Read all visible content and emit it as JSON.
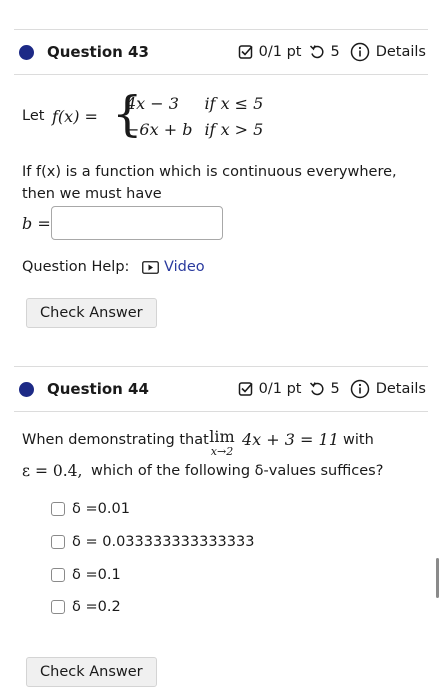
{
  "q43": {
    "title": "Question 43",
    "score": "0/1 pt",
    "attempts": "5",
    "details": "Details",
    "let_text": "Let",
    "fx": "f(x) =",
    "case1_expr": "4x − 3",
    "case1_cond": "if  x ≤ 5",
    "case2_expr": "−6x + b",
    "case2_cond": "if  x > 5",
    "prompt_line1": "If f(x) is a function which is continuous everywhere,",
    "prompt_line2": "then we must have",
    "answer_label": "b =",
    "answer_value": "",
    "help_label": "Question Help:",
    "video_label": "Video",
    "check_label": "Check Answer"
  },
  "q44": {
    "title": "Question 44",
    "score": "0/1 pt",
    "attempts": "5",
    "details": "Details",
    "prompt_line1_a": "When demonstrating that",
    "lim_word": "lim",
    "lim_sub": "x→2",
    "lim_expr": "4x + 3 = 11",
    "prompt_line1_b": "with",
    "prompt_line2_a": "ε = 0.4,",
    "prompt_line2_b": "which of the following δ-values suffices?",
    "options": [
      "δ =0.01",
      "δ = 0.033333333333333",
      "δ =0.1",
      "δ =0.2"
    ],
    "check_label": "Check Answer"
  },
  "colors": {
    "accent": "#1d2a86",
    "link": "#2a3a9e"
  },
  "icons": [
    "score-checkbox-icon",
    "retry-icon",
    "info-icon",
    "video-icon"
  ]
}
